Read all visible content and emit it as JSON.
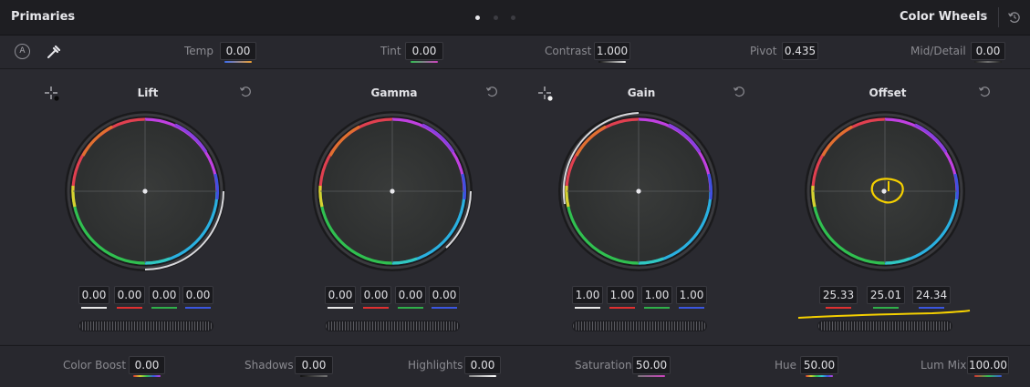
{
  "header": {
    "title": "Primaries",
    "mode": "Color Wheels"
  },
  "adjustments": [
    {
      "label": "Temp",
      "value": "0.00"
    },
    {
      "label": "Tint",
      "value": "0.00"
    },
    {
      "label": "Contrast",
      "value": "1.000"
    },
    {
      "label": "Pivot",
      "value": "0.435"
    },
    {
      "label": "Mid/Detail",
      "value": "0.00"
    }
  ],
  "auto_button": "A",
  "wheels": [
    {
      "name": "Lift",
      "values": [
        "0.00",
        "0.00",
        "0.00",
        "0.00"
      ]
    },
    {
      "name": "Gamma",
      "values": [
        "0.00",
        "0.00",
        "0.00",
        "0.00"
      ]
    },
    {
      "name": "Gain",
      "values": [
        "1.00",
        "1.00",
        "1.00",
        "1.00"
      ]
    },
    {
      "name": "Offset",
      "values": [
        "25.33",
        "25.01",
        "24.34"
      ]
    }
  ],
  "bottom": [
    {
      "label": "Color Boost",
      "value": "0.00"
    },
    {
      "label": "Shadows",
      "value": "0.00"
    },
    {
      "label": "Highlights",
      "value": "0.00"
    },
    {
      "label": "Saturation",
      "value": "50.00"
    },
    {
      "label": "Hue",
      "value": "50.00"
    },
    {
      "label": "Lum Mix",
      "value": "100.00"
    }
  ],
  "colors": {
    "annotation": "#f5d000",
    "red": "#e03030",
    "green": "#2fb04a",
    "blue": "#3a56e0",
    "white": "#e8e8e8"
  }
}
